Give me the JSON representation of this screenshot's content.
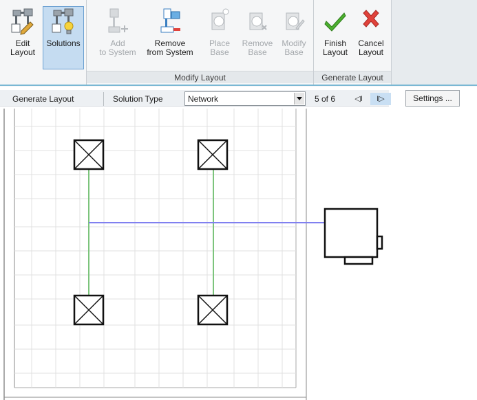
{
  "ribbon": {
    "buttons": {
      "edit_layout": "Edit\nLayout",
      "solutions": "Solutions",
      "add_to_system": "Add\nto System",
      "remove_from_system": "Remove\nfrom System",
      "place_base": "Place\nBase",
      "remove_base": "Remove\nBase",
      "modify_base": "Modify\nBase",
      "finish_layout": "Finish\nLayout",
      "cancel_layout": "Cancel\nLayout"
    },
    "groups": {
      "modify_layout": "Modify Layout",
      "generate_layout": "Generate Layout"
    }
  },
  "options_bar": {
    "mode_label": "Generate Layout",
    "solution_type_label": "Solution Type",
    "solution_type_value": "Network",
    "solution_counter": "5 of 6",
    "prev_label": "◁I",
    "next_label": "I▷",
    "settings_label": "Settings ..."
  },
  "colors": {
    "accent_blue": "#6a9fd1",
    "system_line_green": "#7cc47c",
    "main_line_blue": "#8080f0",
    "finish_check": "#4caf2f",
    "cancel_x": "#e0423b"
  },
  "icons": [
    "edit-layout-icon",
    "solutions-icon",
    "add-to-system-icon",
    "remove-from-system-icon",
    "place-base-icon",
    "remove-base-icon",
    "modify-base-icon",
    "finish-check-icon",
    "cancel-x-icon",
    "select-dropdown-icon"
  ]
}
